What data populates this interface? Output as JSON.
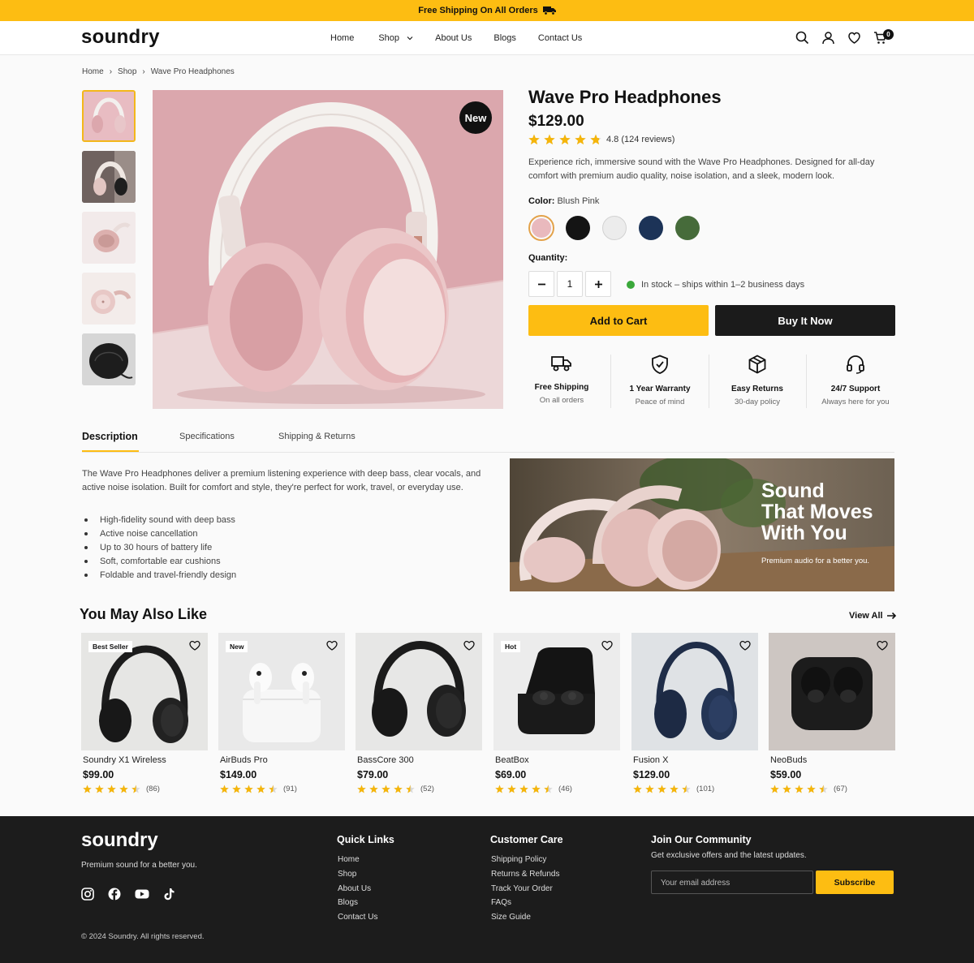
{
  "promo": {
    "text": "Free Shipping On All Orders",
    "icon": "truck-icon"
  },
  "header": {
    "logo": "soundry",
    "nav": [
      "Home",
      "Shop",
      "About Us",
      "Blogs",
      "Contact Us"
    ],
    "cart_count": "0"
  },
  "breadcrumb": [
    "Home",
    "Shop",
    "Wave Pro Headphones"
  ],
  "product": {
    "badge": "New",
    "title": "Wave Pro Headphones",
    "price": "$129.00",
    "rating": 4.8,
    "rating_text": "4.8 (124 reviews)",
    "description": "Experience rich, immersive sound with the Wave Pro Headphones. Designed for all-day comfort with premium audio quality, noise isolation, and a sleek, modern look.",
    "color_label": "Color:",
    "color_value": "Blush Pink",
    "colors": [
      "#e9b9bd",
      "#141414",
      "#ececec",
      "#1c3357",
      "#466b3a"
    ],
    "quantity_label": "Quantity:",
    "quantity": "1",
    "stock": "In stock – ships within 1–2 business days",
    "add_to_cart": "Add to Cart",
    "buy_now": "Buy It Now"
  },
  "features": [
    {
      "title": "Free Shipping",
      "sub": "On all orders",
      "icon": "truck-icon"
    },
    {
      "title": "1 Year Warranty",
      "sub": "Peace of mind",
      "icon": "shield-check-icon"
    },
    {
      "title": "Easy Returns",
      "sub": "30-day policy",
      "icon": "box-icon"
    },
    {
      "title": "24/7 Support",
      "sub": "Always here for you",
      "icon": "headset-icon"
    }
  ],
  "tabs": [
    "Description",
    "Specifications",
    "Shipping & Returns"
  ],
  "description": {
    "text": "The Wave Pro Headphones deliver a premium listening experience with deep bass, clear vocals, and active noise isolation. Built for comfort and style, they're perfect for work, travel, or everyday use.",
    "bullets": [
      "High-fidelity sound with deep bass",
      "Active noise cancellation",
      "Up to 30 hours of battery life",
      "Soft, comfortable ear cushions",
      "Foldable and travel-friendly design"
    ]
  },
  "banner": {
    "title": "Sound That Moves With You",
    "title_lines": [
      "Sound",
      "That Moves",
      "With You"
    ],
    "subtitle": "Premium audio for a better you."
  },
  "related": {
    "title": "You May Also Like",
    "view_all": "View All",
    "items": [
      {
        "badge": "Best Seller",
        "name": "Soundry X1 Wireless",
        "price": "$99.00",
        "rating": 4.5,
        "count": "(86)"
      },
      {
        "badge": "New",
        "name": "AirBuds Pro",
        "price": "$149.00",
        "rating": 4.5,
        "count": "(91)"
      },
      {
        "badge": "",
        "name": "BassCore 300",
        "price": "$79.00",
        "rating": 4.5,
        "count": "(52)"
      },
      {
        "badge": "Hot",
        "name": "BeatBox",
        "price": "$69.00",
        "rating": 4.5,
        "count": "(46)"
      },
      {
        "badge": "",
        "name": "Fusion X",
        "price": "$129.00",
        "rating": 4.5,
        "count": "(101)"
      },
      {
        "badge": "",
        "name": "NeoBuds",
        "price": "$59.00",
        "rating": 4.5,
        "count": "(67)"
      }
    ]
  },
  "footer": {
    "logo": "soundry",
    "tagline": "Premium sound for a better you.",
    "social": [
      "instagram-icon",
      "facebook-icon",
      "youtube-icon",
      "tiktok-icon"
    ],
    "quick_links_title": "Quick Links",
    "quick_links": [
      "Home",
      "Shop",
      "About Us",
      "Blogs",
      "Contact Us"
    ],
    "care_title": "Customer Care",
    "care_links": [
      "Shipping Policy",
      "Returns & Refunds",
      "Track Your Order",
      "FAQs",
      "Size Guide"
    ],
    "community_title": "Join Our Community",
    "community_text": "Get exclusive offers and the latest updates.",
    "email_placeholder": "Your email address",
    "subscribe": "Subscribe",
    "copyright": "© 2024 Soundry. All rights reserved."
  },
  "colors": {
    "accent": "#fdbd12",
    "dark": "#1c1c1c",
    "star": "#f5b50a",
    "stock": "#3aa83a"
  }
}
